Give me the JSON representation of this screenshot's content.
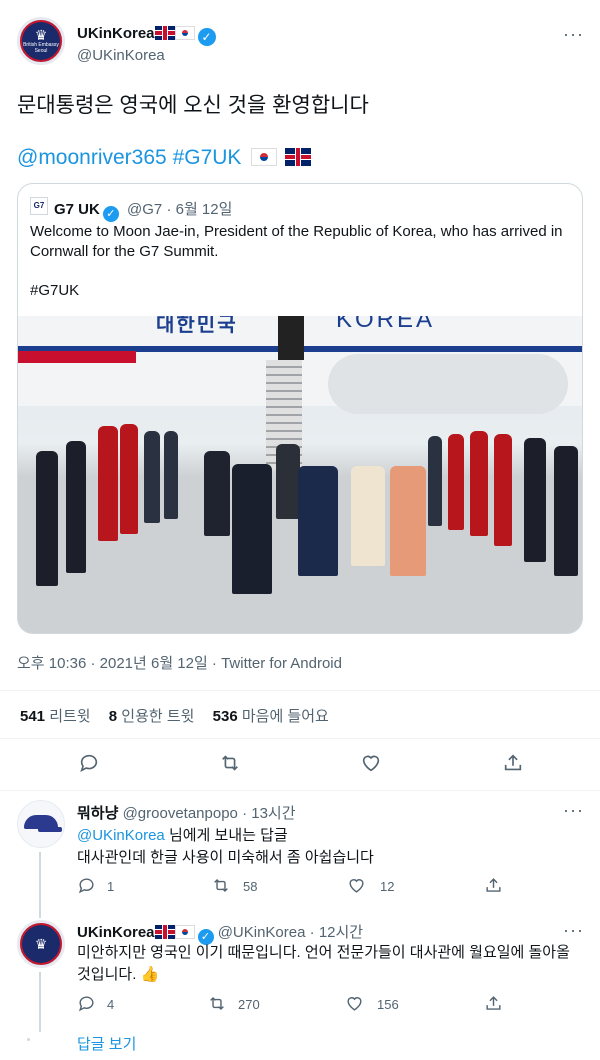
{
  "tweet": {
    "author_name": "UKinKorea",
    "author_handle": "@UKinKorea",
    "avatar_text": "British Embassy Seoul",
    "text": "문대통령은 영국에 오신 것을 환영합니다",
    "mention": "@moonriver365",
    "hashtag": "#G7UK",
    "timestamp": "오후 10:36 · 2021년 6월 12일 · Twitter for Android",
    "stats": {
      "retweets": "541",
      "retweets_label": "리트윗",
      "quotes": "8",
      "quotes_label": "인용한 트윗",
      "likes": "536",
      "likes_label": "마음에 들어요"
    }
  },
  "quoted": {
    "author_name": "G7 UK",
    "author_handle": "@G7",
    "date": "6월 12일",
    "logo_text": "G7",
    "text": "Welcome to Moon Jae-in, President of the Republic of Korea, who has arrived in Cornwall for the G7 Summit.",
    "hashtag": "#G7UK",
    "photo_text_plane_left": "대한민국",
    "photo_text_plane_right": "KOREA"
  },
  "replies": [
    {
      "author_name": "뭐하냥",
      "author_handle": "@groovetanpopo",
      "time": "13시간",
      "replying_to_handle": "@UKinKorea",
      "replying_to_suffix": "님에게 보내는 답글",
      "text": "대사관인데 한글 사용이 미숙해서 좀 아쉽습니다",
      "replies": "1",
      "retweets": "58",
      "likes": "12"
    },
    {
      "author_name": "UKinKorea",
      "author_handle": "@UKinKorea",
      "time": "12시간",
      "text": "미안하지만 영국인 이기 때문입니다. 언어 전문가들이 대사관에 월요일에 돌아올 것입니다. 👍",
      "replies": "4",
      "retweets": "270",
      "likes": "156"
    }
  ],
  "show_replies": "답글 보기",
  "icons": {
    "more": "more-icon",
    "reply": "reply-icon",
    "retweet": "retweet-icon",
    "like": "like-icon",
    "share": "share-icon",
    "verified": "verified-icon"
  },
  "colors": {
    "link": "#1b95e0",
    "verified": "#1d9bf0",
    "secondary_text": "#536471"
  }
}
